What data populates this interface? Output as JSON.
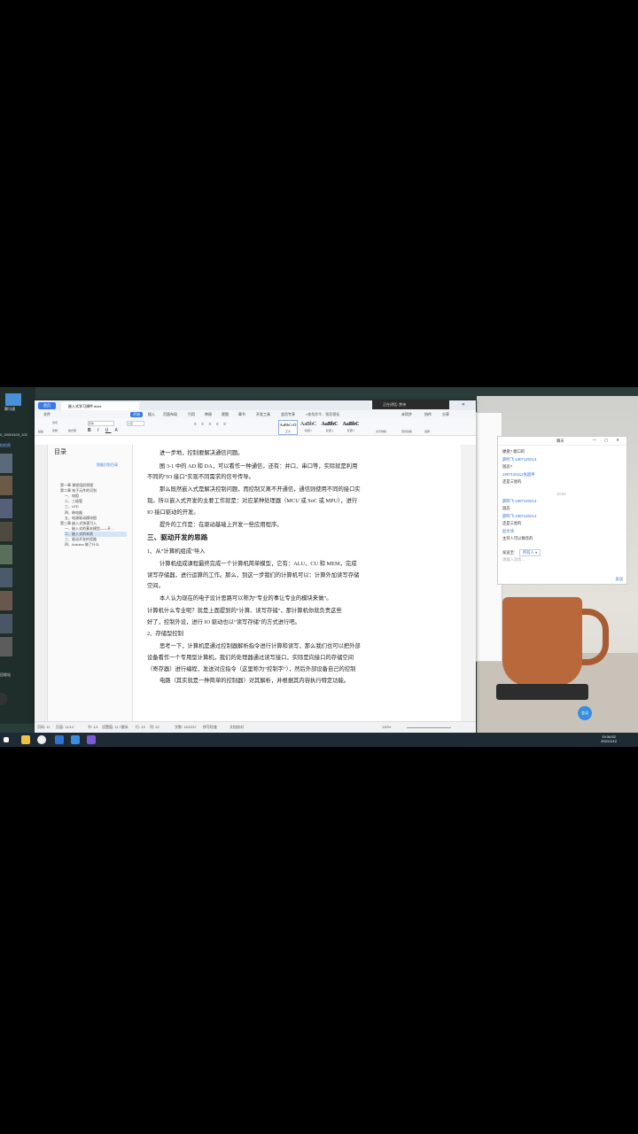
{
  "desktop": {
    "left_icon_label": "腾讯通",
    "left_file_label": "0_20201103_102",
    "left_link_label": "拍拍照",
    "bottom_icon_label": "回收站"
  },
  "meeting_banner": "正在讲话: 詹伟",
  "wps": {
    "home_tab": "首页",
    "doc_tab": "嵌入式学习课件.docx",
    "menus": [
      "文件",
      "开始",
      "插入",
      "页面布局",
      "引用",
      "审阅",
      "视图",
      "章节",
      "开发工具",
      "会员专享"
    ],
    "search_placeholder": "查找命令、搜索模板",
    "right_menu": [
      "未同步",
      "协作",
      "分享"
    ],
    "ribbon": {
      "paste": "粘贴",
      "cut": "剪切",
      "copy": "复制",
      "format_painter": "格式刷",
      "font_name": "宋体",
      "font_size": "小四",
      "styles": [
        {
          "preview": "AaBbCcD",
          "label": "正文"
        },
        {
          "preview": "AaBbC",
          "label": "标题 1"
        },
        {
          "preview": "AaBbC",
          "label": "标题 2"
        },
        {
          "preview": "AaBbC",
          "label": "标题 3"
        }
      ],
      "text_tools": "文字排版",
      "find_replace": "查找替换",
      "select": "选择"
    },
    "toc": {
      "title": "目录",
      "smart_btn": "智能识别目录",
      "items": [
        {
          "text": "第一章 课程组织原理",
          "level": 1
        },
        {
          "text": "第二章 电子元件的识别",
          "level": 1
        },
        {
          "text": "一、电阻",
          "level": 2
        },
        {
          "text": "二、三极管",
          "level": 2
        },
        {
          "text": "三、LED",
          "level": 2
        },
        {
          "text": "四、继电器",
          "level": 2
        },
        {
          "text": "五、电源驱动模块图",
          "level": 2
        },
        {
          "text": "第三章 嵌入式快速引入",
          "level": 1
        },
        {
          "text": "一、嵌入式的基本模型——开…",
          "level": 2
        },
        {
          "text": "二、嵌入式的本质",
          "level": 2,
          "selected": true
        },
        {
          "text": "三、驱动开发的思路",
          "level": 2
        },
        {
          "text": "四、Arduino 做了什么",
          "level": 2
        }
      ]
    },
    "doc_lines": [
      "进一步地，控制要解决通信问题。",
      "图 3-1 中的 AD 和 DA，可以看作一种通信，还有：并口、串口等，实际就是利用",
      "不同的“IO 接口”实现不同需求的信号传导。",
      "那么既然嵌入式是解决控制问题，而控制又离不开通信，通信则使用不同的接口实",
      "现。所以嵌入式开发的主要工作就是：对应某种处理器（MCU 或 SoC 或 MPU），进行",
      "IO 接口驱动的开发。",
      "提升的工作是：在驱动基础上开发一些应用程序。",
      "三、驱动开发的思路",
      "1、从“计算机组成”导入",
      "计算机组成课程最终完成一个计算机简单模型，它有：ALU、CU 和 MEM，完成",
      "读写存储器，进行运算的工作。那么，到这一步我们的计算机可以：计算外加读写存储",
      "空间。",
      "本人认为现在的电子设计思路可以称为“专业的事让专业的模块来做”。",
      "计算机什么专业呢？就是上面提到的“计算、读写存储”，那计算机你就负责这些",
      "好了，控制外设，进行 IO 驱动也以“读写存储”的方式进行吧。",
      "2、存储型控制",
      "思考一下，计算机是通过控制器解析指令进行计算和读写，那么我们也可以把外部",
      "设备看作一个专用型计算机，我们的处理器通过读写接口，实际是向接口的存储空间",
      "（寄存器）进行编程，发送对应指令（这里称为“控制字”），然后外部设备自己的控制",
      "电路（其实就是一种简单的控制器）对其解析，并根据其内容执行特定功能。"
    ],
    "status": {
      "page": "页码: 11",
      "pages": "页面: 11/14",
      "section": "节: 1/1",
      "position": "设置值: 11.7厘米",
      "row": "行: 13",
      "col": "列: 22",
      "words": "字数: 15/2237",
      "spell": "拼写检查",
      "doc_check": "文档校对",
      "zoom": "130%"
    }
  },
  "chat": {
    "title": "聊天",
    "messages": [
      {
        "text": "硬盘? 端口的",
        "color": "dark"
      },
      {
        "text": "薛明飞-1907120214",
        "color": "blue"
      },
      {
        "text": "固态?",
        "color": "dark"
      },
      {
        "text": "1907120112张超坤",
        "color": "blue"
      },
      {
        "text": "还是三星的",
        "color": "dark"
      },
      {
        "text": "19:50",
        "color": "grey"
      },
      {
        "text": "薛明飞-1907120214",
        "color": "blue"
      },
      {
        "text": "固态",
        "color": "dark"
      },
      {
        "text": "薛明飞-1907120214",
        "color": "blue"
      },
      {
        "text": "还是三星的",
        "color": "dark"
      },
      {
        "text": "赵文涛",
        "color": "blue"
      },
      {
        "text": "主持人可以静音的",
        "color": "dark"
      }
    ],
    "send_to_label": "发送至:",
    "send_to_value": "所有人",
    "input_placeholder": "请输入消息...",
    "send_btn": "发送"
  },
  "taskbar": {
    "time": "19:34:52",
    "date": "2021/1/12"
  },
  "avatar_label": "会议"
}
